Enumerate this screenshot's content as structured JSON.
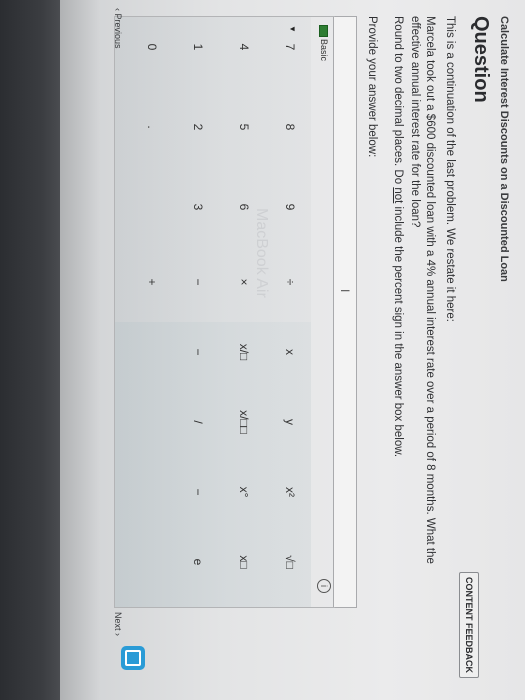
{
  "breadcrumb": "Calculate Interest Discounts on a Discounted Loan",
  "question_title": "Question",
  "content_feedback_label": "CONTENT FEEDBACK",
  "question": {
    "line1": "This is a continuation of the last problem. We restate it here:",
    "line2": "Marcela took out a $600 discounted loan with a 4% annual interest rate over a period of 8 months. What the effective annual interest rate for the loan?",
    "line3_pre": "Round to two decimal places. Do ",
    "line3_underlined": "not",
    "line3_post": " include the percent sign in the answer box below.",
    "line4": "Provide your answer below:"
  },
  "answer": {
    "value": "",
    "caret": "I"
  },
  "toolbar": {
    "mode_label": "Basic",
    "info_symbol": "i"
  },
  "keypad": {
    "rows": [
      [
        "7",
        "8",
        "9",
        "÷"
      ],
      [
        "4",
        "5",
        "6",
        "×"
      ],
      [
        "1",
        "2",
        "3",
        "−"
      ],
      [
        "0",
        ".",
        "",
        "+"
      ]
    ],
    "functions": [
      [
        "x",
        "y",
        "x²",
        "√□"
      ],
      [
        "x/□",
        "x/□□",
        "x°",
        "x□"
      ],
      [
        "−",
        "/",
        "−",
        "e"
      ]
    ]
  },
  "nav": {
    "previous_label": "‹ Previous",
    "next_label": "Next ›"
  },
  "watermark": "MacBook Air",
  "colors": {
    "help_button": "#2a9bd6",
    "keyboard_icon": "#2e7d32"
  }
}
